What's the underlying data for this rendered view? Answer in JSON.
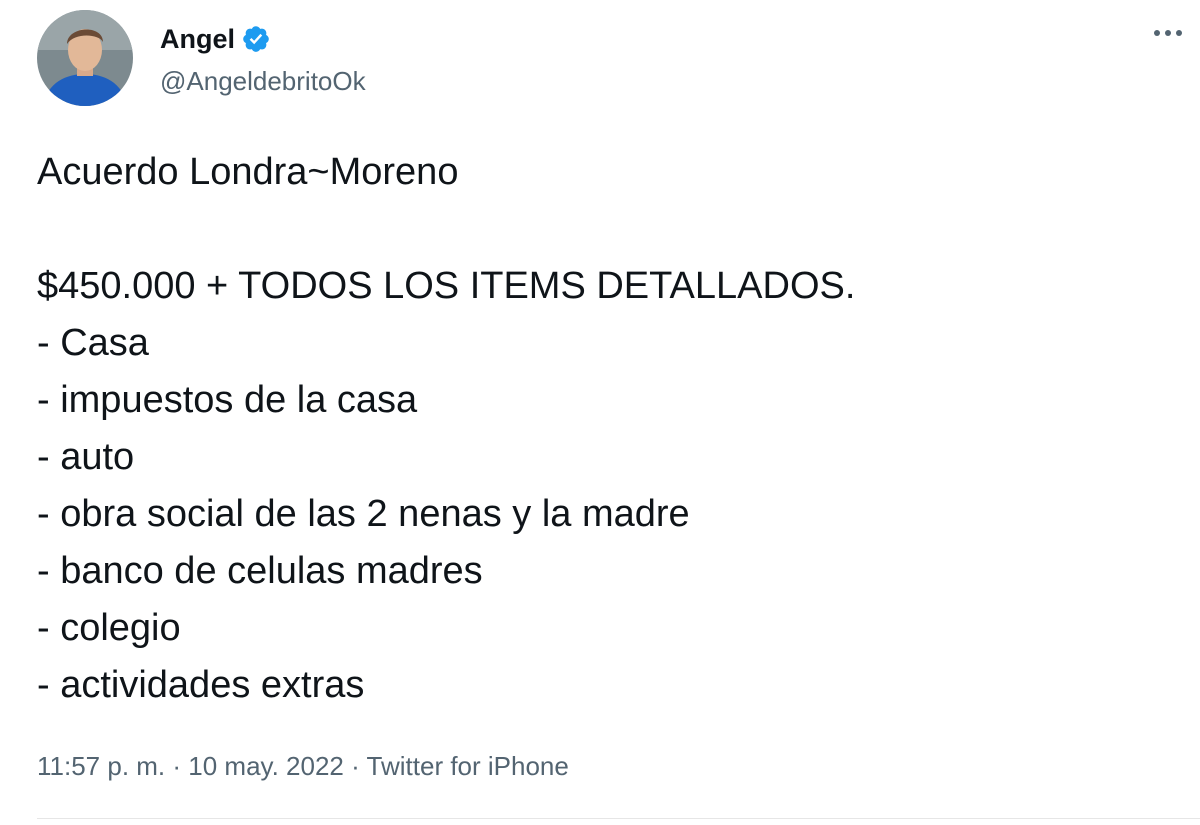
{
  "author": {
    "name": "Angel",
    "handle": "@AngeldebritoOk",
    "verified": true,
    "verified_color": "#1d9bf0"
  },
  "more_menu": {
    "icon": "more-horizontal-icon"
  },
  "tweet": {
    "lines": [
      "Acuerdo Londra~Moreno",
      "",
      "$450.000 + TODOS LOS ITEMS DETALLADOS.",
      "- Casa",
      "- impuestos de la casa",
      "- auto",
      "- obra social de las 2 nenas y la madre",
      "- banco de celulas madres",
      "- colegio",
      "- actividades extras"
    ]
  },
  "meta": {
    "time": "11:57 p. m.",
    "separator": " · ",
    "date": "10 may. 2022",
    "source": "Twitter for iPhone"
  },
  "colors": {
    "text": "#0f1419",
    "secondary": "#536471"
  }
}
